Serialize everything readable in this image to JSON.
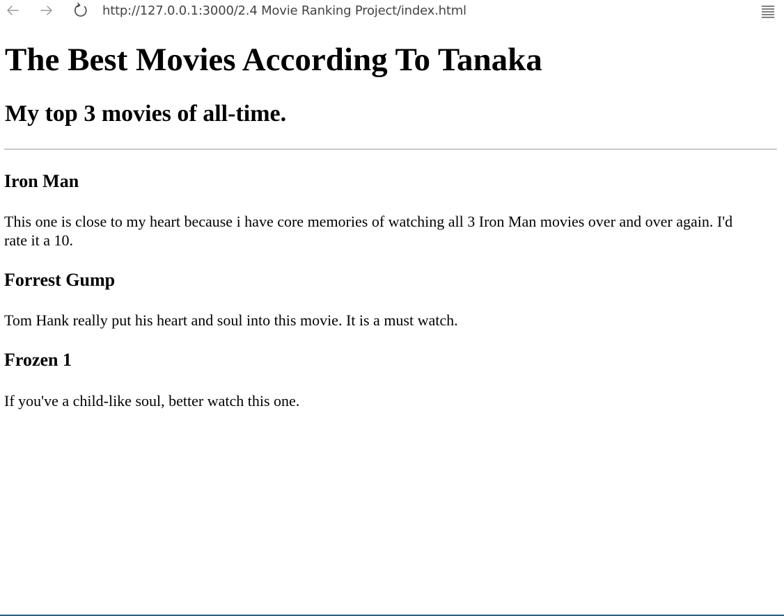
{
  "browser": {
    "url": "http://127.0.0.1:3000/2.4 Movie Ranking Project/index.html",
    "icons": {
      "back": "arrow-left-icon",
      "forward": "arrow-right-icon",
      "reload": "reload-icon",
      "menu": "hamburger-menu-icon"
    }
  },
  "page": {
    "title": "The Best Movies According To Tanaka",
    "subtitle": "My top 3 movies of all-time.",
    "movies": [
      {
        "title": "Iron Man",
        "description": "This one is close to my heart because i have core memories of watching all 3 Iron Man movies over and over again. I'd rate it a 10."
      },
      {
        "title": "Forrest Gump",
        "description": "Tom Hank really put his heart and soul into this movie. It is a must watch."
      },
      {
        "title": "Frozen 1",
        "description": "If you've a child-like soul, better watch this one."
      }
    ]
  }
}
